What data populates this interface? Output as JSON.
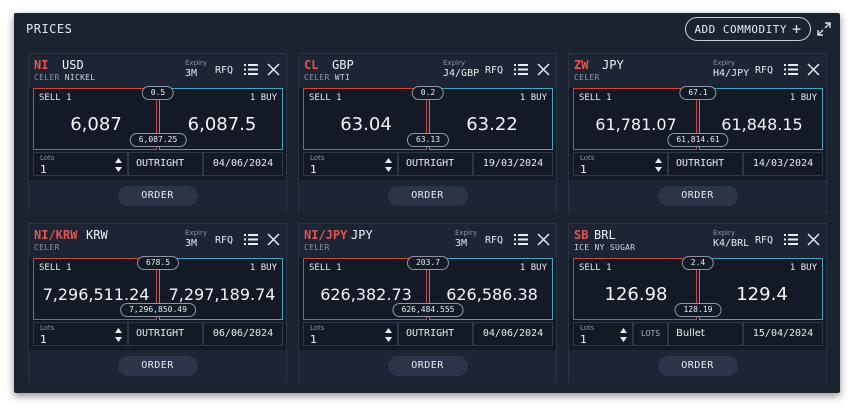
{
  "header": {
    "title": "PRICES",
    "add_label": "ADD COMMODITY",
    "add_glyph": "+",
    "expand_icon": "expand-icon"
  },
  "labels": {
    "expiry": "Expiry",
    "rfq": "RFQ",
    "sell": "SELL 1",
    "buy": "1 BUY",
    "lots": "Lots",
    "order": "ORDER"
  },
  "cards": [
    {
      "code": "NI",
      "ccy": "USD",
      "exch": "CELER",
      "name": "NICKEL",
      "expiry": "3M",
      "spread": "0.5",
      "sell": "6,087",
      "buy": "6,087.5",
      "mid": "6,087.25",
      "lots": "1",
      "mode": "OUTRIGHT",
      "date": "04/06/2024"
    },
    {
      "code": "CL",
      "ccy": "GBP",
      "exch": "CELER",
      "name": "WTI",
      "expiry": "J4/GBP",
      "spread": "0.2",
      "sell": "63.04",
      "buy": "63.22",
      "mid": "63.13",
      "lots": "1",
      "mode": "OUTRIGHT",
      "date": "19/03/2024"
    },
    {
      "code": "ZW",
      "ccy": "JPY",
      "exch": "CELER",
      "name": "",
      "expiry": "H4/JPY",
      "spread": "67.1",
      "sell": "61,781.07",
      "buy": "61,848.15",
      "mid": "61,814.61",
      "lots": "1",
      "mode": "OUTRIGHT",
      "date": "14/03/2024"
    },
    {
      "code": "NI/KRW",
      "ccy": "KRW",
      "exch": "CELER",
      "name": "",
      "expiry": "3M",
      "spread": "678.5",
      "sell": "7,296,511.24",
      "buy": "7,297,189.74",
      "mid": "7,296,850.49",
      "lots": "1",
      "mode": "OUTRIGHT",
      "date": "06/06/2024"
    },
    {
      "code": "NI/JPY",
      "ccy": "JPY",
      "exch": "CELER",
      "name": "",
      "expiry": "3M",
      "spread": "203.7",
      "sell": "626,382.73",
      "buy": "626,586.38",
      "mid": "626,484.555",
      "lots": "1",
      "mode": "OUTRIGHT",
      "date": "04/06/2024"
    },
    {
      "code": "SB",
      "ccy": "BRL",
      "exch": "ICE",
      "name": "NY SUGAR",
      "expiry": "K4/BRL",
      "spread": "2.4",
      "sell": "126.98",
      "buy": "129.4",
      "mid": "128.19",
      "lots": "1",
      "unit": "LOTS",
      "mode": "Bullet",
      "date": "15/04/2024"
    }
  ],
  "colors": {
    "sell": "#c7493f",
    "buy": "#3fa5c4",
    "code": "#e2564f",
    "background": "#1b2230"
  }
}
